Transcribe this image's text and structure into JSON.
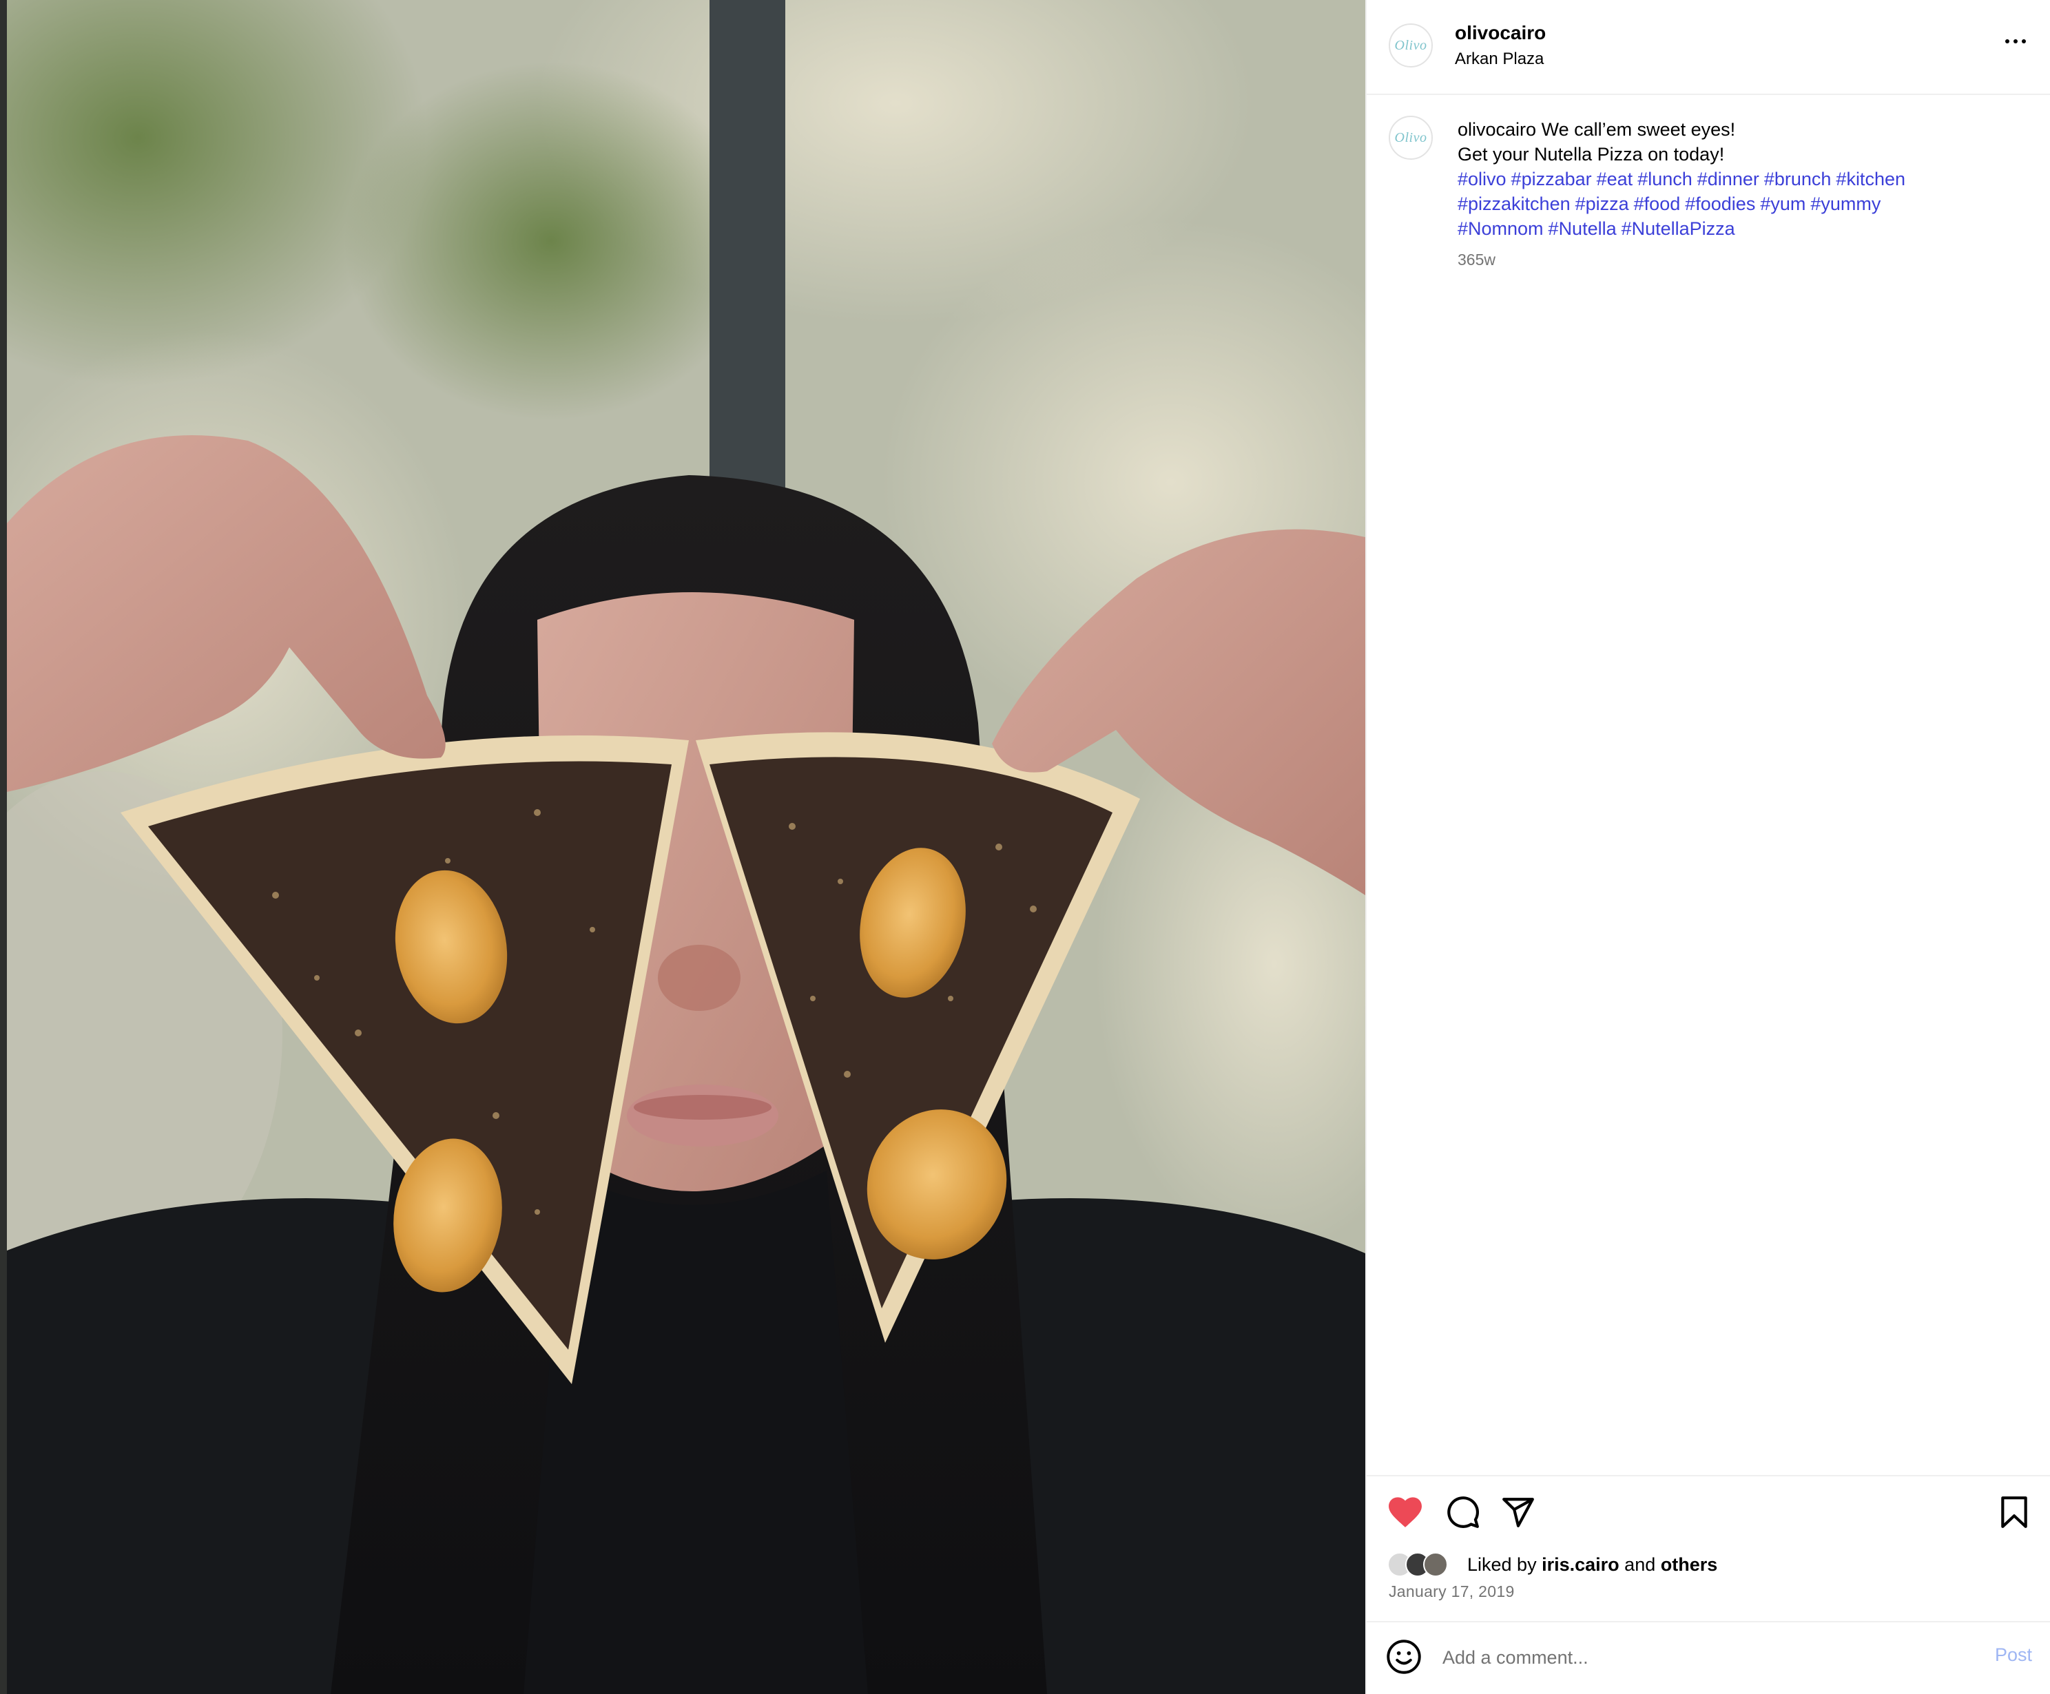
{
  "post": {
    "username": "olivocairo",
    "location": "Arkan Plaza",
    "avatar_logo": "Olivo",
    "caption": {
      "username": "olivocairo",
      "line1": "We call’em sweet eyes!",
      "line2": "Get your Nutella Pizza on today!",
      "hashtags": [
        "#olivo",
        "#pizzabar",
        "#eat",
        "#lunch",
        "#dinner",
        "#brunch",
        "#kitchen",
        "#pizzakitchen",
        "#pizza",
        "#food",
        "#foodies",
        "#yum",
        "#yummy",
        "#Nomnom",
        "#Nutella",
        "#NutellaPizza"
      ]
    },
    "time_ago": "365w",
    "likes": {
      "prefix": "Liked by",
      "user": "iris.cairo",
      "and": "and",
      "others": "others"
    },
    "date": "January 17, 2019"
  },
  "comment": {
    "placeholder": "Add a comment...",
    "post_label": "Post"
  },
  "icons": {
    "more": "more-options-icon",
    "like": "heart-icon",
    "comment": "comment-icon",
    "share": "share-icon",
    "save": "bookmark-icon",
    "emoji": "emoji-icon"
  },
  "colors": {
    "like_active": "#ed4956",
    "hashtag": "#3b3fd8",
    "muted": "#737373",
    "post_disabled": "#9fb6f3",
    "logo": "#7fc4cc"
  }
}
